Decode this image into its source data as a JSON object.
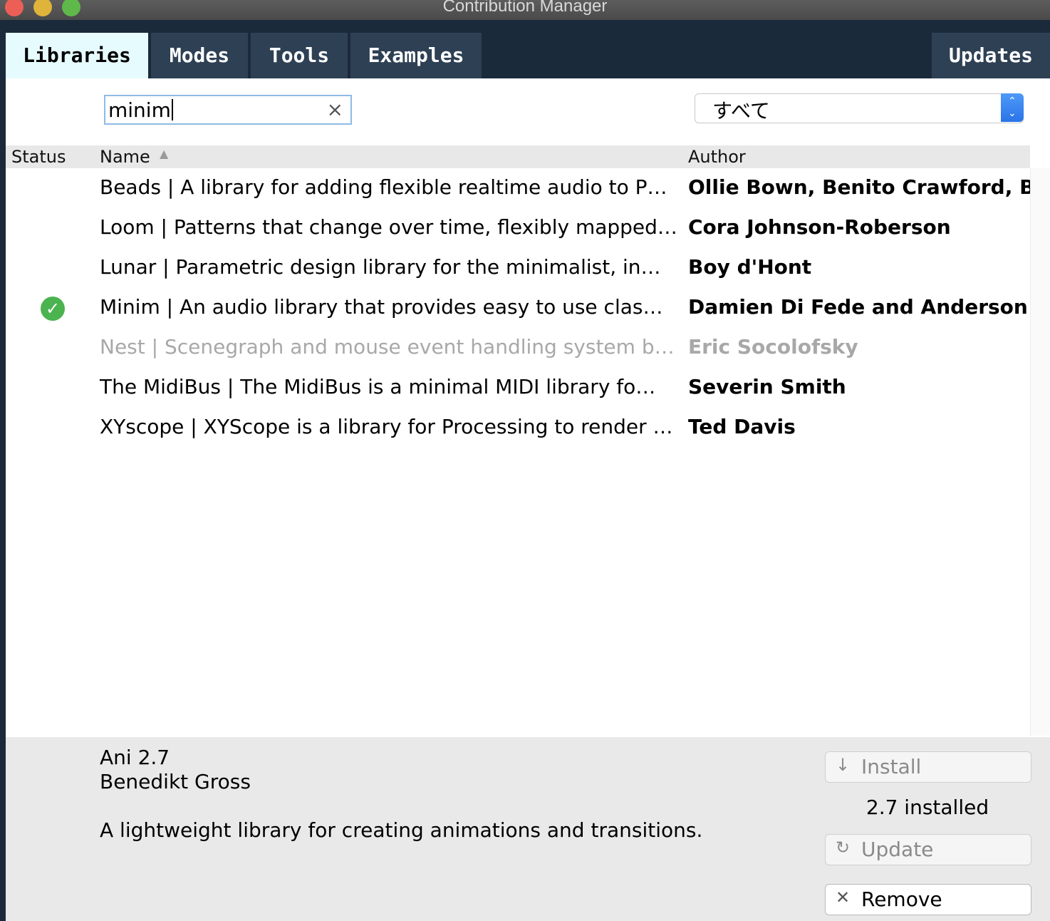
{
  "window": {
    "title": "Contribution Manager"
  },
  "tabs": [
    {
      "label": "Libraries",
      "active": true
    },
    {
      "label": "Modes",
      "active": false
    },
    {
      "label": "Tools",
      "active": false
    },
    {
      "label": "Examples",
      "active": false
    }
  ],
  "updates_tab": {
    "label": "Updates"
  },
  "search": {
    "value": "minim",
    "clear_icon": "×"
  },
  "category_filter": {
    "selected": "すべて"
  },
  "table": {
    "columns": {
      "status": "Status",
      "name": "Name",
      "author": "Author"
    },
    "sort": {
      "column": "Name",
      "direction": "ascending"
    },
    "rows": [
      {
        "name": "Beads | A library for adding flexible realtime audio to P…",
        "author": "Ollie Bown, Benito Crawford, Be…",
        "installed": false,
        "dim": false
      },
      {
        "name": "Loom | Patterns that change over time, flexibly mapped…",
        "author": "Cora Johnson-Roberson",
        "installed": false,
        "dim": false
      },
      {
        "name": "Lunar | Parametric design library for the minimalist, in…",
        "author": "Boy d'Hont",
        "installed": false,
        "dim": false
      },
      {
        "name": "Minim | An audio library that provides easy to use clas…",
        "author": "Damien Di Fede and Anderson …",
        "installed": true,
        "dim": false
      },
      {
        "name": "Nest | Scenegraph and mouse event handling system b…",
        "author": "Eric Socolofsky",
        "installed": false,
        "dim": true
      },
      {
        "name": "The MidiBus | The MidiBus is a minimal MIDI library fo…",
        "author": "Severin Smith",
        "installed": false,
        "dim": false
      },
      {
        "name": "XYscope | XYScope is a library for Processing to render …",
        "author": "Ted Davis",
        "installed": false,
        "dim": false
      }
    ]
  },
  "detail": {
    "title": "Ani 2.7",
    "author": "Benedikt Gross",
    "description": "A lightweight library for creating animations and transitions.",
    "installed_text": "2.7 installed",
    "install_label": "Install",
    "update_label": "Update",
    "remove_label": "Remove"
  },
  "colors": {
    "tab_bar": "#1b2a3b",
    "tab": "#2e4054",
    "active_tab": "#e6fbfe",
    "installed_check": "#4bb34f"
  }
}
